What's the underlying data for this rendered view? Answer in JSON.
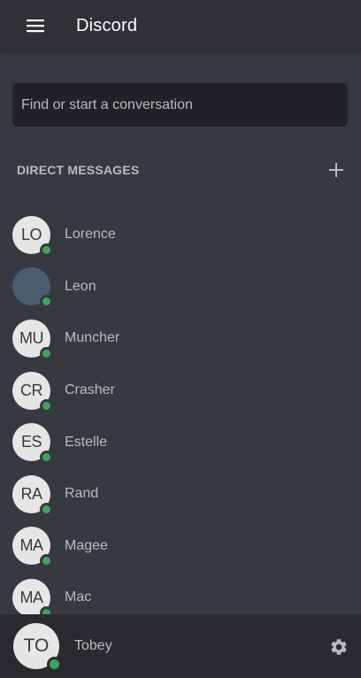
{
  "header": {
    "title": "Discord",
    "menu_icon": "hamburger-menu-icon"
  },
  "search": {
    "placeholder": "Find or start a conversation",
    "value": ""
  },
  "direct_messages": {
    "title": "DIRECT MESSAGES",
    "add_icon": "plus-icon",
    "items": [
      {
        "initials": "LO",
        "name": "Lorence",
        "status": "online",
        "has_avatar_image": false
      },
      {
        "initials": "",
        "name": "Leon",
        "status": "online",
        "has_avatar_image": true
      },
      {
        "initials": "MU",
        "name": "Muncher",
        "status": "online",
        "has_avatar_image": false
      },
      {
        "initials": "CR",
        "name": "Crasher",
        "status": "online",
        "has_avatar_image": false
      },
      {
        "initials": "ES",
        "name": "Estelle",
        "status": "online",
        "has_avatar_image": false
      },
      {
        "initials": "RA",
        "name": "Rand",
        "status": "online",
        "has_avatar_image": false
      },
      {
        "initials": "MA",
        "name": "Magee",
        "status": "online",
        "has_avatar_image": false
      },
      {
        "initials": "MA",
        "name": "Mac",
        "status": "online",
        "has_avatar_image": false
      }
    ]
  },
  "footer": {
    "user_initials": "TO",
    "user_name": "Tobey",
    "status": "online",
    "settings_icon": "gear-icon"
  },
  "colors": {
    "background": "#36393f",
    "header": "#2f3136",
    "search_bg": "#202225",
    "footer": "#292b2f",
    "online": "#3ba55c",
    "text_muted": "#b9bbbe"
  }
}
